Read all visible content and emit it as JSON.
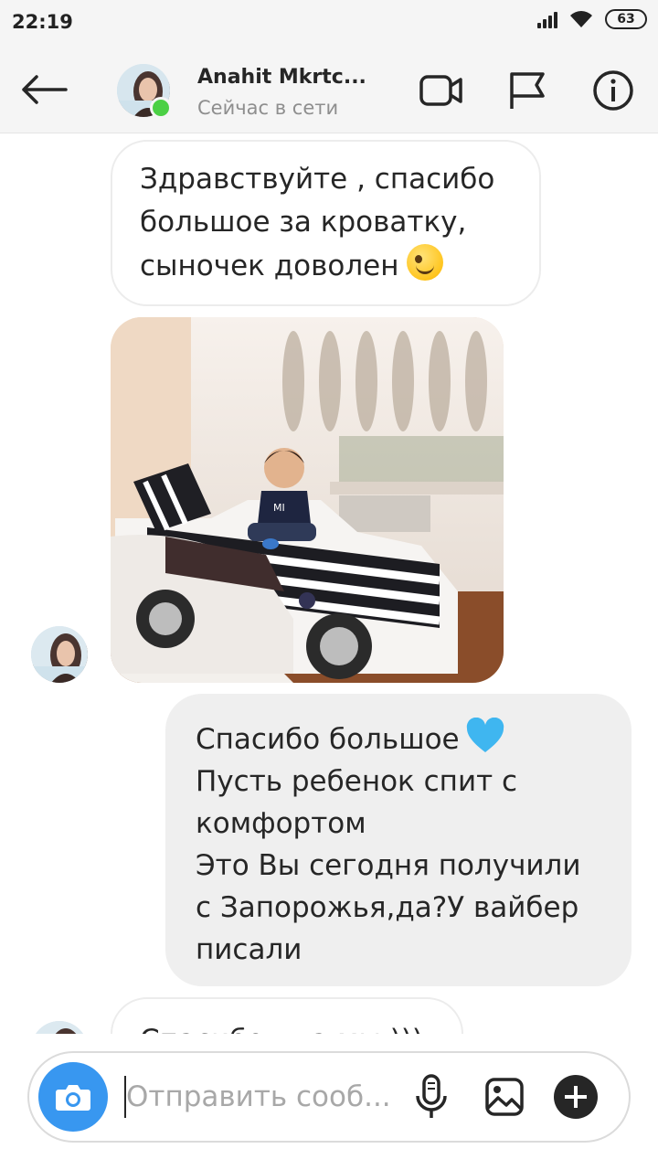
{
  "status_bar": {
    "time": "22:19",
    "battery": "63"
  },
  "header": {
    "name": "Anahit Mkrtc...",
    "status": "Сейчас в сети",
    "icons": [
      "back-arrow-icon",
      "video-call-icon",
      "flag-icon",
      "info-icon"
    ]
  },
  "messages": [
    {
      "direction": "in",
      "lines": [
        "Здравствуйте , спасибо",
        "большое за кроватку,",
        "сыночек доволен"
      ],
      "emoji": "wink"
    },
    {
      "direction": "in",
      "type": "photo",
      "description": "photo"
    },
    {
      "direction": "out",
      "lines": [
        "Спасибо большое",
        "Пусть ребенок спит с",
        "комфортом",
        "Это Вы сегодня получили",
        "с Запорожья,да?У вайбер",
        "писали"
      ],
      "emoji": "blue-heart"
    },
    {
      "direction": "in",
      "lines": [
        "Спасибо , да мы )))"
      ]
    }
  ],
  "composer": {
    "placeholder": "Отправить сооб...",
    "icons": [
      "camera-icon",
      "microphone-icon",
      "gallery-icon",
      "plus-icon"
    ]
  },
  "colors": {
    "accent": "#3897f0",
    "online": "#4bd045",
    "heart": "#3fb6f0",
    "bubble_out": "#efefef"
  }
}
